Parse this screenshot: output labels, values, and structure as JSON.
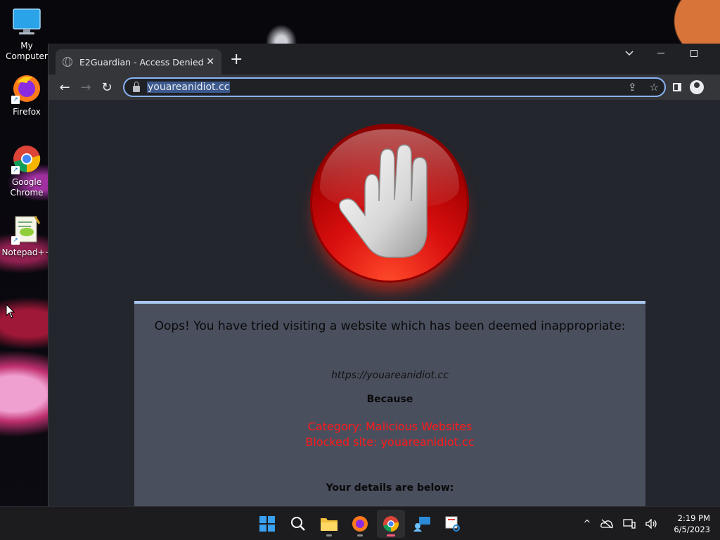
{
  "desktop": {
    "icons": [
      {
        "label": "My Computer"
      },
      {
        "label": "Firefox"
      },
      {
        "label": "Google Chrome"
      },
      {
        "label": "Notepad++"
      }
    ]
  },
  "browser": {
    "tab": {
      "title": "E2Guardian - Access Denied",
      "close": "✕"
    },
    "new_tab": "+",
    "window_controls": {
      "dropdown": "⌄",
      "minimize": "—",
      "maximize": "☐"
    },
    "nav": {
      "back": "←",
      "forward": "→",
      "reload": "↻"
    },
    "address": {
      "url": "youareanidiot.cc"
    },
    "omnibox_icons": {
      "share": "⇪",
      "bookmark": "☆"
    }
  },
  "page": {
    "headline": "Oops! You have tried visiting a website which has been deemed inappropriate:",
    "blocked_url": "https://youareanidiot.cc",
    "because": "Because",
    "category": "Category: Malicious Websites",
    "blocked_site": "Blocked site: youareanidiot.cc",
    "details": "Your details are below:"
  },
  "taskbar": {
    "clock_time": "2:19 PM",
    "clock_date": "6/5/2023",
    "tray_chevron": "^"
  },
  "colors": {
    "accent": "#8ab4f8",
    "error_text": "#ff1a1a",
    "panel_bg": "#4a4f5e",
    "panel_border": "#a9c8ef"
  }
}
